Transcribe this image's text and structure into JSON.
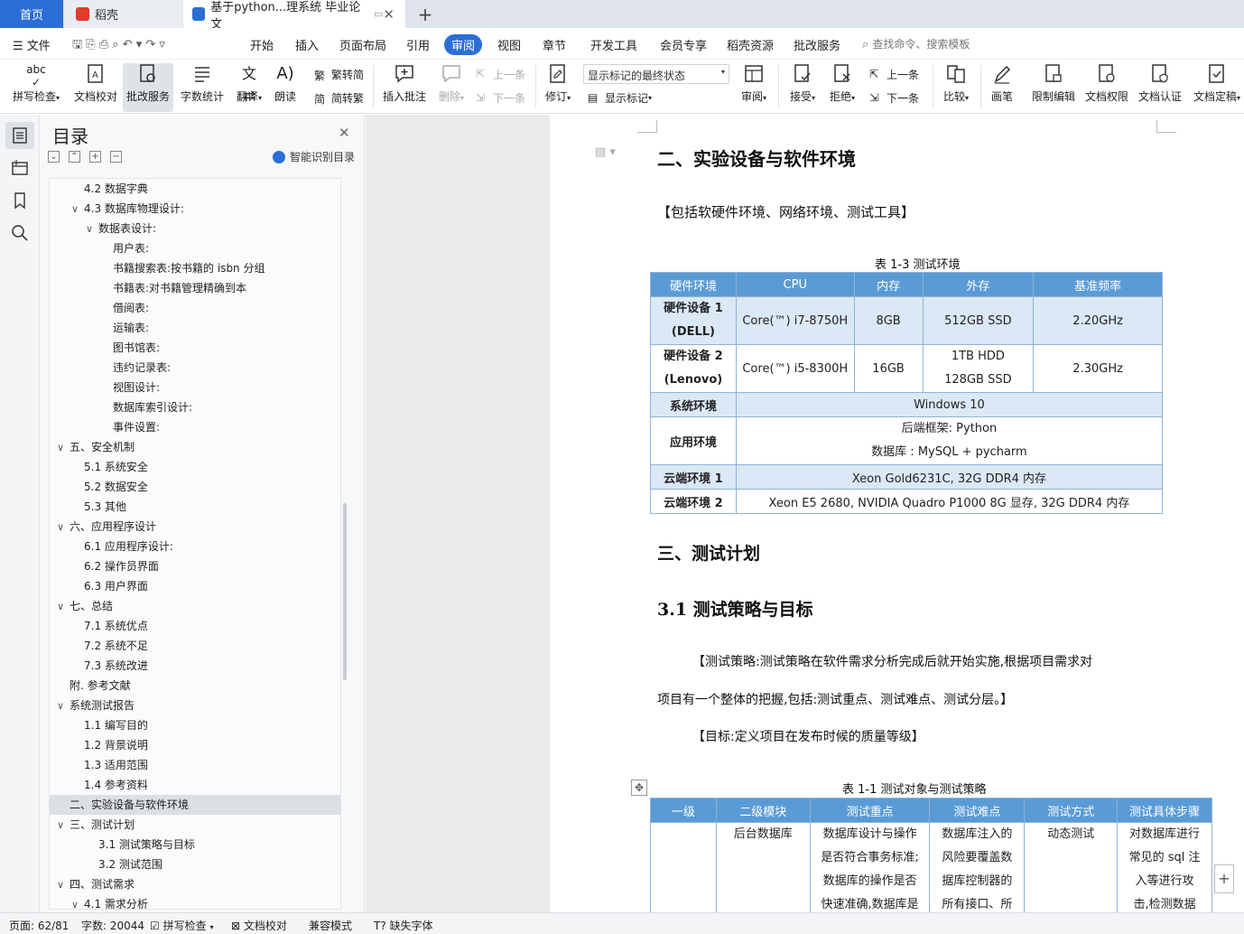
{
  "tabs": {
    "home": "首页",
    "daoke": "稻壳",
    "doc": "基于python...理系统 毕业论文"
  },
  "menu": {
    "file": "文件",
    "items": [
      "开始",
      "插入",
      "页面布局",
      "引用",
      "审阅",
      "视图",
      "章节",
      "开发工具",
      "会员专享",
      "稻壳资源",
      "批改服务"
    ],
    "search": "查找命令、搜索模板"
  },
  "toolbar": {
    "spell": "拼写检查",
    "proof": "文档校对",
    "correct": "批改服务",
    "count": "字数统计",
    "translate": "翻译",
    "read": "朗读",
    "trad": "繁转简",
    "simp": "简转繁",
    "insert_comment": "插入批注",
    "delete": "删除",
    "prev_comment": "上一条",
    "next_comment": "下一条",
    "revise": "修订",
    "mark_state": "显示标记的最终状态",
    "show_mark": "显示标记",
    "review": "审阅",
    "accept": "接受",
    "reject": "拒绝",
    "prev": "上一条",
    "next": "下一条",
    "compare": "比较",
    "pen": "画笔",
    "restrict": "限制编辑",
    "rights": "文档权限",
    "cert": "文档认证",
    "final": "文档定稿"
  },
  "toc": {
    "title": "目录",
    "smart": "智能识别目录",
    "items": [
      {
        "t": "4.2  数据字典",
        "lv": 2,
        "c": ""
      },
      {
        "t": "4.3 数据库物理设计:",
        "lv": 2,
        "c": "v"
      },
      {
        "t": "数据表设计:",
        "lv": 3,
        "c": "v"
      },
      {
        "t": "用户表:",
        "lv": 4,
        "c": ""
      },
      {
        "t": "书籍搜索表:按书籍的 isbn 分组",
        "lv": 4,
        "c": ""
      },
      {
        "t": "书籍表:对书籍管理精确到本",
        "lv": 4,
        "c": ""
      },
      {
        "t": "借阅表:",
        "lv": 4,
        "c": ""
      },
      {
        "t": "运输表:",
        "lv": 4,
        "c": ""
      },
      {
        "t": "图书馆表:",
        "lv": 4,
        "c": ""
      },
      {
        "t": "违约记录表:",
        "lv": 4,
        "c": ""
      },
      {
        "t": "视图设计:",
        "lv": 4,
        "c": ""
      },
      {
        "t": "数据库索引设计:",
        "lv": 4,
        "c": ""
      },
      {
        "t": "事件设置:",
        "lv": 4,
        "c": ""
      },
      {
        "t": "五、安全机制",
        "lv": 1,
        "c": "v"
      },
      {
        "t": "5.1  系统安全",
        "lv": 2,
        "c": ""
      },
      {
        "t": "5.2  数据安全",
        "lv": 2,
        "c": ""
      },
      {
        "t": "5.3  其他",
        "lv": 2,
        "c": ""
      },
      {
        "t": "六、应用程序设计",
        "lv": 1,
        "c": "v"
      },
      {
        "t": "6.1 应用程序设计:",
        "lv": 2,
        "c": ""
      },
      {
        "t": "6.2 操作员界面",
        "lv": 2,
        "c": ""
      },
      {
        "t": "6.3 用户界面",
        "lv": 2,
        "c": ""
      },
      {
        "t": "七、总结",
        "lv": 1,
        "c": "v"
      },
      {
        "t": "7.1  系统优点",
        "lv": 2,
        "c": ""
      },
      {
        "t": "7.2  系统不足",
        "lv": 2,
        "c": ""
      },
      {
        "t": "7.3  系统改进",
        "lv": 2,
        "c": ""
      },
      {
        "t": "附. 参考文献",
        "lv": 1,
        "c": ""
      },
      {
        "t": "系统测试报告",
        "lv": 1,
        "c": "v"
      },
      {
        "t": "1.1  编写目的",
        "lv": 2,
        "c": ""
      },
      {
        "t": "1.2  背景说明",
        "lv": 2,
        "c": ""
      },
      {
        "t": "1.3  适用范围",
        "lv": 2,
        "c": ""
      },
      {
        "t": "1.4  参考资料",
        "lv": 2,
        "c": ""
      },
      {
        "t": "二、实验设备与软件环境",
        "lv": 1,
        "c": "",
        "sel": true
      },
      {
        "t": "三、测试计划",
        "lv": 1,
        "c": "v"
      },
      {
        "t": "3.1 测试策略与目标",
        "lv": 3,
        "c": ""
      },
      {
        "t": "3.2 测试范围",
        "lv": 3,
        "c": ""
      },
      {
        "t": "四、测试需求",
        "lv": 1,
        "c": "v"
      },
      {
        "t": "4.1  需求分析",
        "lv": 2,
        "c": "v"
      }
    ]
  },
  "doc": {
    "h2": "二、实验设备与软件环境",
    "note": "【包括软硬件环境、网络环境、测试工具】",
    "cap1": "表 1-3  测试环境",
    "t1": {
      "head": [
        "硬件环境",
        "CPU",
        "内存",
        "外存",
        "基准频率"
      ],
      "r1": [
        "硬件设备 1",
        "(DELL)",
        "Core(™) i7-8750H",
        "8GB",
        "512GB SSD",
        "2.20GHz"
      ],
      "r2": [
        "硬件设备 2",
        "(Lenovo)",
        "Core(™) i5-8300H",
        "16GB",
        "1TB HDD",
        "128GB SSD",
        "2.30GHz"
      ],
      "r3": [
        "系统环境",
        "Windows 10"
      ],
      "r4": [
        "应用环境",
        "后端框架:  Python",
        "数据库 :  MySQL + pycharm"
      ],
      "r5": [
        "云端环境 1",
        "Xeon Gold6231C,  32G DDR4 内存"
      ],
      "r6": [
        "云端环境 2",
        "Xeon E5 2680,  NVIDIA Quadro P1000 8G 显存,  32G DDR4 内存"
      ]
    },
    "h3": "三、测试计划",
    "h31": "3.1 测试策略与目标",
    "p1": "【测试策略:测试策略在软件需求分析完成后就开始实施,根据项目需求对",
    "p2": "项目有一个整体的把握,包括:测试重点、测试难点、测试分层。】",
    "p3": "【目标:定义项目在发布时候的质量等级】",
    "cap2": "表 1-1  测试对象与测试策略",
    "t2": {
      "head": [
        "一级",
        "二级模块",
        "测试重点",
        "测试难点",
        "测试方式",
        "测试具体步骤"
      ],
      "c2": "后台数据库",
      "c3": [
        "数据库设计与操作",
        "是否符合事务标准;",
        "数据库的操作是否",
        "快速准确,数据库是"
      ],
      "c4": [
        "数据库注入的",
        "风险要覆盖数",
        "据库控制器的",
        "所有接口、所"
      ],
      "c5": "动态测试",
      "c6": [
        "对数据库进行",
        "常见的 sql 注",
        "入等进行攻",
        "击,检测数据"
      ]
    }
  },
  "status": {
    "page": "页面: 62/81",
    "words": "字数: 20044",
    "spell": "拼写检查",
    "proof": "文档校对",
    "compat": "兼容模式",
    "font": "缺失字体"
  }
}
